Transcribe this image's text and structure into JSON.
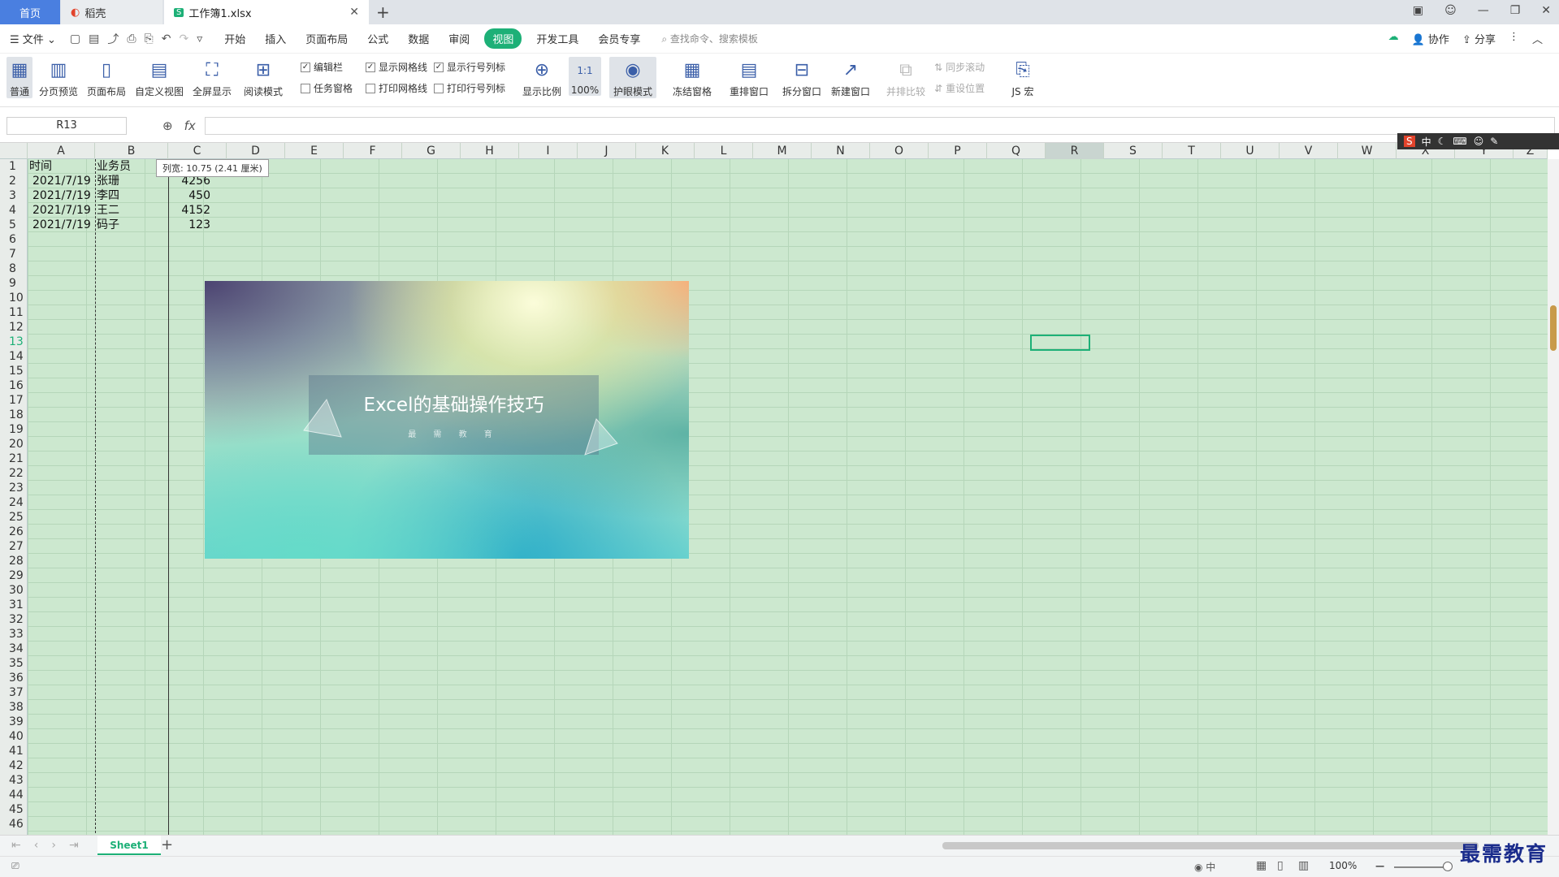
{
  "tabs": {
    "home": "首页",
    "daoke": "稻壳",
    "workbook": "工作簿1.xlsx"
  },
  "menu": {
    "file": "文件",
    "items": [
      "开始",
      "插入",
      "页面布局",
      "公式",
      "数据",
      "审阅",
      "视图",
      "开发工具",
      "会员专享"
    ],
    "active": "视图",
    "search_placeholder": "查找命令、搜索模板",
    "collab": "协作",
    "share": "分享"
  },
  "ribbon": {
    "normal": "普通",
    "page_preview": "分页预览",
    "page_layout": "页面布局",
    "custom_view": "自定义视图",
    "fullscreen": "全屏显示",
    "reading_mode": "阅读模式",
    "formula_bar": "编辑栏",
    "task_pane": "任务窗格",
    "show_gridlines": "显示网格线",
    "print_gridlines": "打印网格线",
    "show_headers": "显示行号列标",
    "print_headers": "打印行号列标",
    "zoom": "显示比例",
    "zoom100": "100%",
    "zoom100_icon": "1:1",
    "eye_mode": "护眼模式",
    "freeze": "冻结窗格",
    "arrange": "重排窗口",
    "split": "拆分窗口",
    "new_window": "新建窗口",
    "side_by_side": "并排比较",
    "sync_scroll": "同步滚动",
    "reset_pos": "重设位置",
    "macro": "JS 宏"
  },
  "formula": {
    "name_box": "R13",
    "fx": "fx"
  },
  "columns": [
    "A",
    "B",
    "C",
    "D",
    "E",
    "F",
    "G",
    "H",
    "I",
    "J",
    "K",
    "L",
    "M",
    "N",
    "O",
    "P",
    "Q",
    "R",
    "S",
    "T",
    "U",
    "V",
    "W",
    "X",
    "Y",
    "Z"
  ],
  "selected_column": "R",
  "selected_row": 13,
  "tooltip": "列宽: 10.75 (2.41 厘米)",
  "cells": {
    "a1": "时间",
    "b1": "业务员",
    "a2": "2021/7/19",
    "b2": "张珊",
    "c2": "4256",
    "a3": "2021/7/19",
    "b3": "李四",
    "c3": "450",
    "a4": "2021/7/19",
    "b4": "王二",
    "c4": "4152",
    "a5": "2021/7/19",
    "b5": "码子",
    "c5": "123"
  },
  "picture": {
    "title": "Excel的基础操作技巧",
    "subtitle": "最 需 教 育"
  },
  "sheet": {
    "name": "Sheet1"
  },
  "status": {
    "zoom": "100%"
  },
  "ime": {
    "mode": "中"
  },
  "watermark": "最需教育"
}
